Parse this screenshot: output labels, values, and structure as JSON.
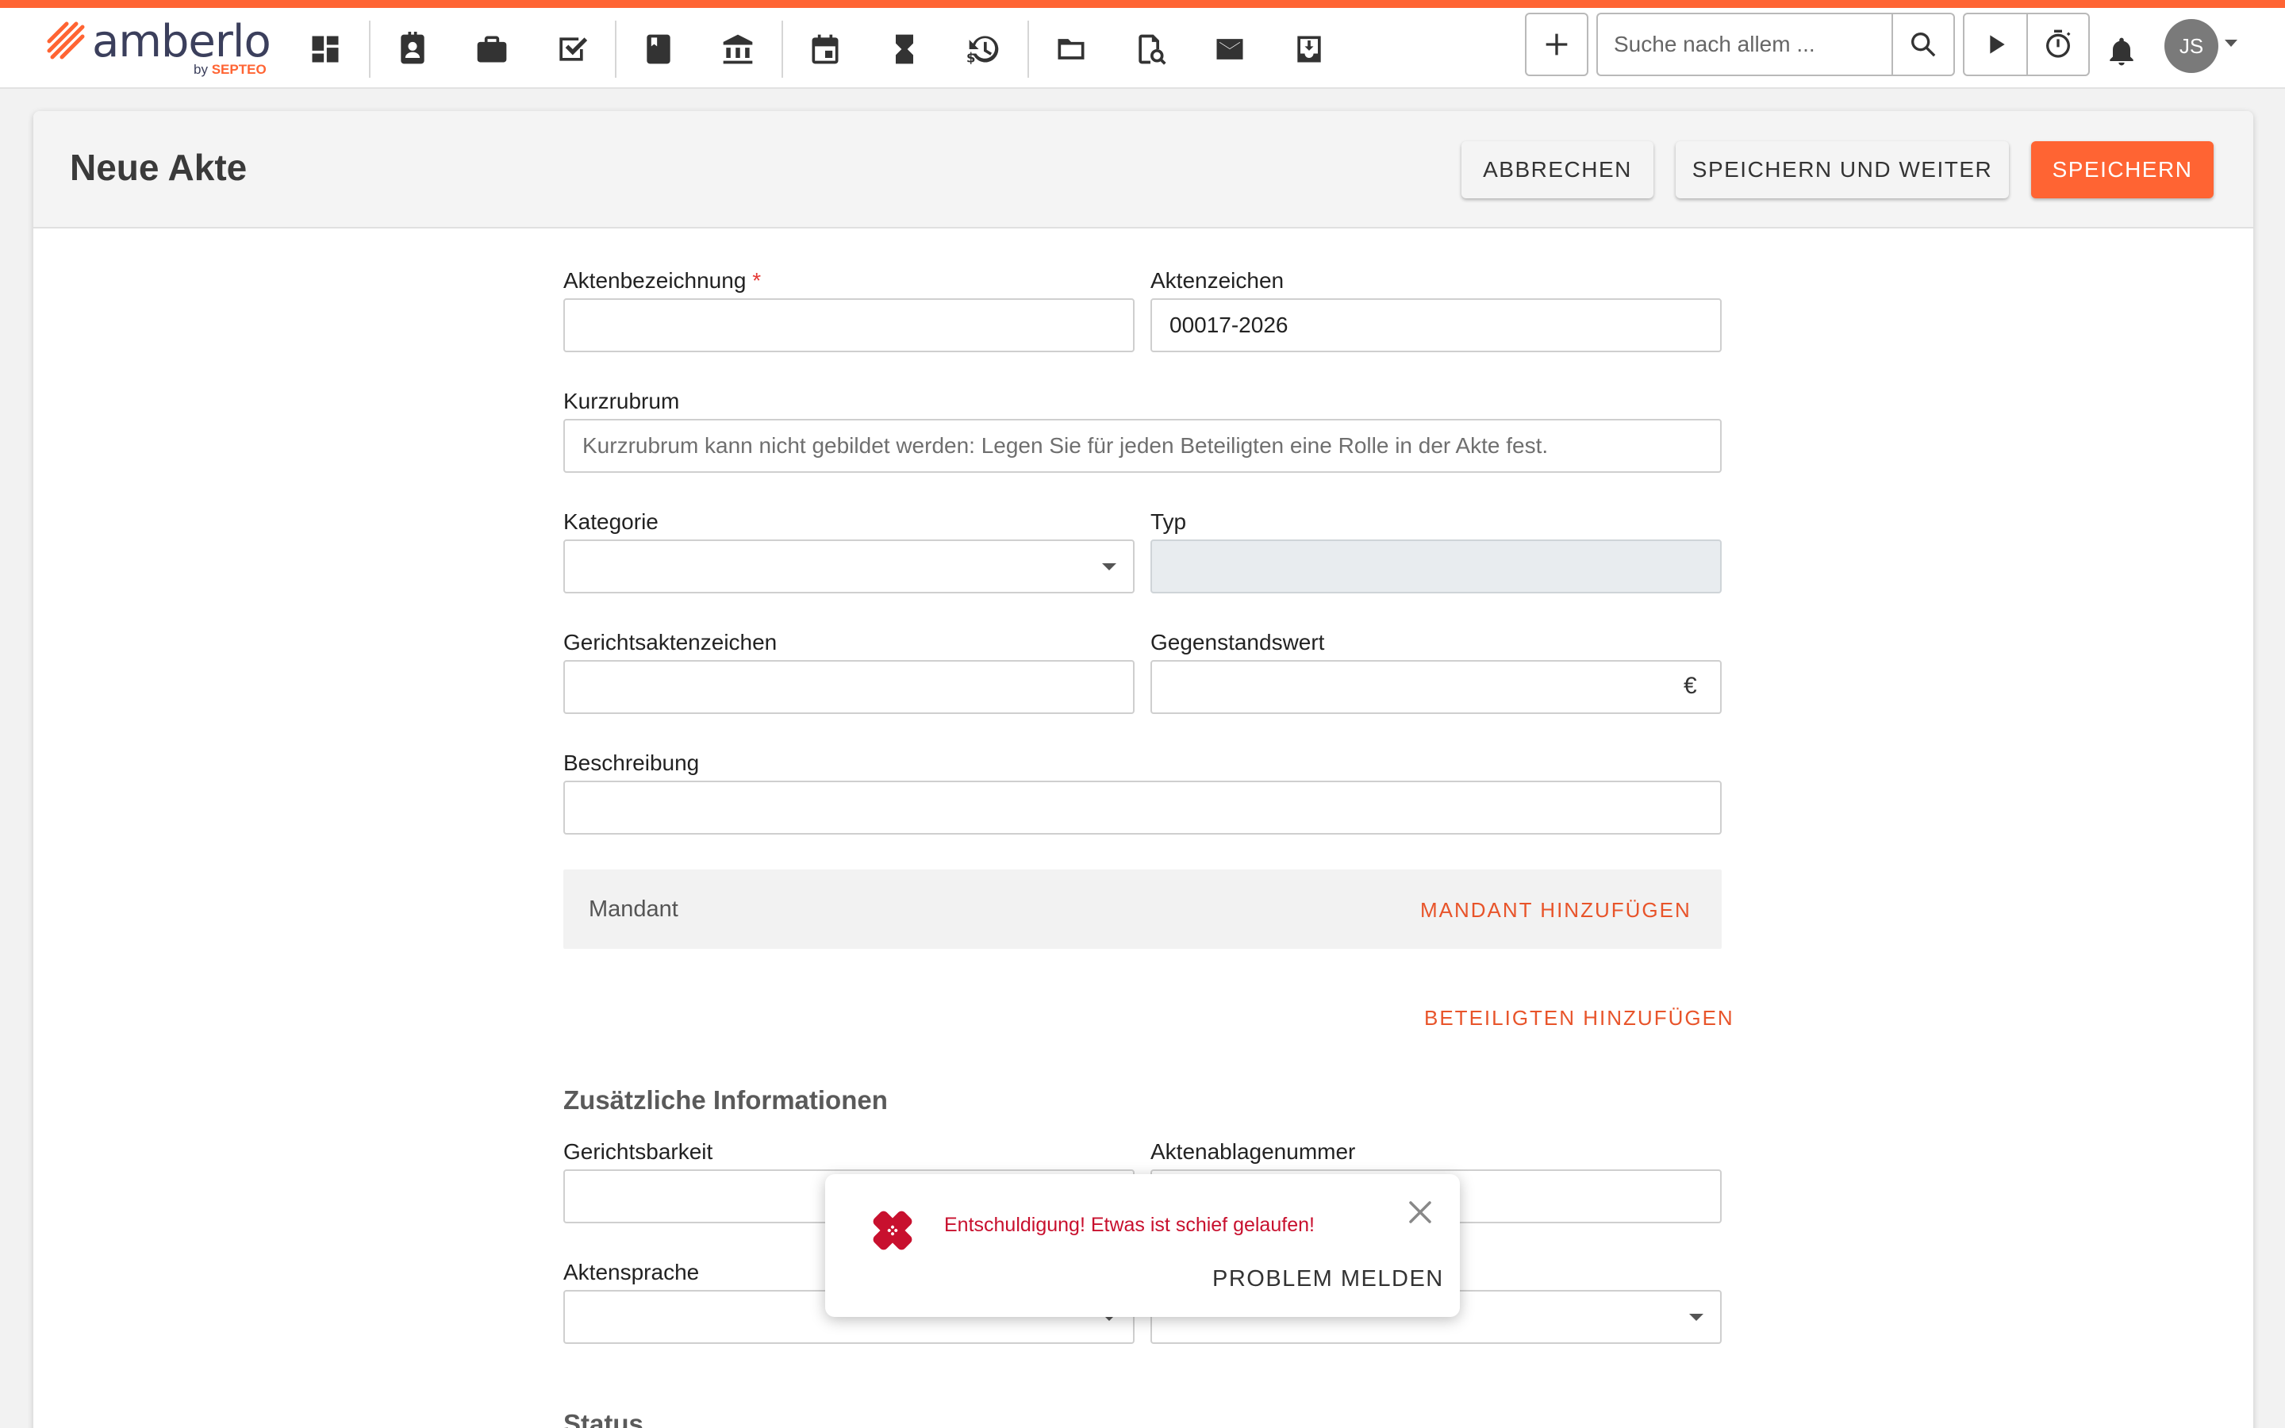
{
  "app": {
    "brand_name": "amberlo",
    "brand_by": "by",
    "brand_company": "SEPTEO",
    "accent_color": "#ff6433"
  },
  "nav": {
    "icons": [
      "dashboard-icon",
      "contacts-icon",
      "briefcase-icon",
      "tasks-icon",
      "book-icon",
      "bank-icon",
      "calendar-icon",
      "hourglass-icon",
      "billing-history-icon",
      "folder-icon",
      "document-search-icon",
      "mail-icon",
      "inbox-download-icon"
    ]
  },
  "toolbar": {
    "search_placeholder": "Suche nach allem ...",
    "user_initials": "JS"
  },
  "page": {
    "title": "Neue Akte",
    "cancel_label": "ABBRECHEN",
    "save_continue_label": "SPEICHERN UND WEITER",
    "save_label": "SPEICHERN"
  },
  "form": {
    "aktenbezeichnung_label": "Aktenbezeichnung",
    "required_mark": "*",
    "aktenbezeichnung_value": "",
    "aktenzeichen_label": "Aktenzeichen",
    "aktenzeichen_value": "00017-2026",
    "kurzrubrum_label": "Kurzrubrum",
    "kurzrubrum_placeholder": "Kurzrubrum kann nicht gebildet werden: Legen Sie für jeden Beteiligten eine Rolle in der Akte fest.",
    "kategorie_label": "Kategorie",
    "typ_label": "Typ",
    "gerichtsaktenzeichen_label": "Gerichtsaktenzeichen",
    "gegenstandswert_label": "Gegenstandswert",
    "currency_symbol": "€",
    "beschreibung_label": "Beschreibung",
    "mandant_label": "Mandant",
    "add_mandant_label": "MANDANT HINZUFÜGEN",
    "add_beteiligten_label": "BETEILIGTEN HINZUFÜGEN",
    "zusatz_title": "Zusätzliche Informationen",
    "gerichtsbarkeit_label": "Gerichtsbarkeit",
    "aktenablagenummer_label": "Aktenablagenummer",
    "aktensprache_label": "Aktensprache",
    "status_label": "Status"
  },
  "toast": {
    "message": "Entschuldigung! Etwas ist schief gelaufen!",
    "report_label": "PROBLEM MELDEN",
    "error_color": "#c8102e"
  }
}
